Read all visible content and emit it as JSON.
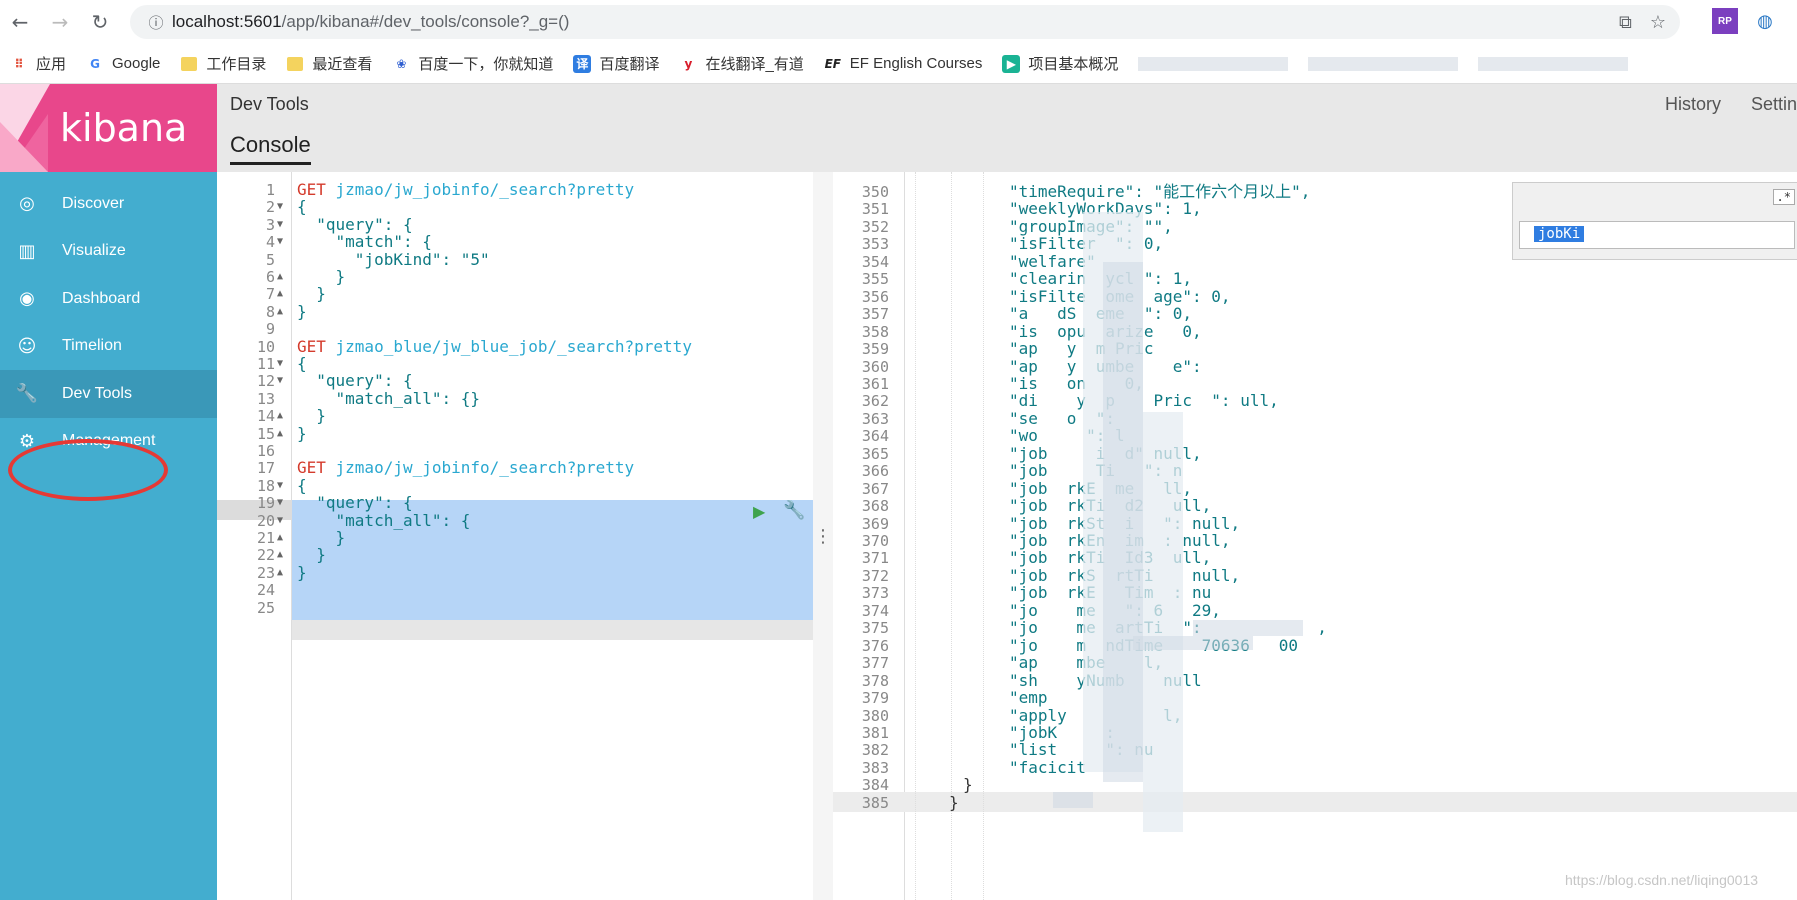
{
  "browser": {
    "url_host": "localhost:5601",
    "url_path": "/app/kibana#/dev_tools/console?_g=()",
    "back": "←",
    "forward": "→",
    "reload": "↻",
    "info": "ⓘ",
    "translate": "⧉",
    "star": "☆",
    "bookmarks": [
      {
        "label": "应用",
        "icon": "apps-grid-icon"
      },
      {
        "label": "Google",
        "icon": "google-icon"
      },
      {
        "label": "工作目录",
        "icon": "folder-icon"
      },
      {
        "label": "最近查看",
        "icon": "folder-icon"
      },
      {
        "label": "百度一下，你就知道",
        "icon": "baidu-icon"
      },
      {
        "label": "百度翻译",
        "icon": "baidu-translate-icon"
      },
      {
        "label": "在线翻译_有道",
        "icon": "youdao-icon"
      },
      {
        "label": "EF English Courses",
        "icon": "ef-icon"
      },
      {
        "label": "项目基本概况",
        "icon": "project-icon"
      }
    ]
  },
  "sidebar": {
    "logo_text": "kibana",
    "items": [
      {
        "label": "Discover",
        "icon": "compass-icon",
        "glyph": "◎"
      },
      {
        "label": "Visualize",
        "icon": "bar-chart-icon",
        "glyph": "▥"
      },
      {
        "label": "Dashboard",
        "icon": "dashboard-icon",
        "glyph": "◉"
      },
      {
        "label": "Timelion",
        "icon": "timelion-icon",
        "glyph": "☺"
      },
      {
        "label": "Dev Tools",
        "icon": "wrench-icon",
        "glyph": "🔧"
      },
      {
        "label": "Management",
        "icon": "gear-icon",
        "glyph": "⚙"
      }
    ]
  },
  "header": {
    "title": "Dev Tools",
    "tab": "Console",
    "history": "History",
    "settings": "Settin"
  },
  "request_editor": {
    "lines": [
      {
        "n": "1",
        "method": "GET",
        "path": "jzmao/jw_jobinfo/_search?pretty"
      },
      {
        "n": "2",
        "text": "{"
      },
      {
        "n": "3",
        "text": "  \"query\": {"
      },
      {
        "n": "4",
        "text": "    \"match\": {"
      },
      {
        "n": "5",
        "text": "      \"jobKind\": \"5\""
      },
      {
        "n": "6",
        "text": "    }"
      },
      {
        "n": "7",
        "text": "  }"
      },
      {
        "n": "8",
        "text": "}"
      },
      {
        "n": "9",
        "text": ""
      },
      {
        "n": "10",
        "method": "GET",
        "path": "jzmao_blue/jw_blue_job/_search?pretty"
      },
      {
        "n": "11",
        "text": "{"
      },
      {
        "n": "12",
        "text": "  \"query\": {"
      },
      {
        "n": "13",
        "text": "    \"match_all\": {}"
      },
      {
        "n": "14",
        "text": "  }"
      },
      {
        "n": "15",
        "text": "}"
      },
      {
        "n": "16",
        "text": ""
      },
      {
        "n": "17",
        "method": "GET",
        "path": "jzmao/jw_jobinfo/_search?pretty"
      },
      {
        "n": "18",
        "text": "{"
      },
      {
        "n": "19",
        "text": "  \"query\": {"
      },
      {
        "n": "20",
        "text": "    \"match_all\": {"
      },
      {
        "n": "21",
        "text": "    }"
      },
      {
        "n": "22",
        "text": "  }"
      },
      {
        "n": "23",
        "text": "}"
      },
      {
        "n": "24",
        "text": ""
      },
      {
        "n": "25",
        "text": ""
      }
    ],
    "play_icon": "▶",
    "wrench_icon": "🔧"
  },
  "response_editor": {
    "lines": [
      {
        "n": "350",
        "text": "\"timeRequire\": \"能工作六个月以上\","
      },
      {
        "n": "351",
        "text": "\"weeklyWorkDays\": 1,"
      },
      {
        "n": "352",
        "text": "\"groupImage\": \"\","
      },
      {
        "n": "353",
        "text": "\"isFilter  \": 0,"
      },
      {
        "n": "354",
        "text": "\"welfare\""
      },
      {
        "n": "355",
        "text": "\"clearin  ycl \": 1,"
      },
      {
        "n": "356",
        "text": "\"isFilte  ome  age\": 0,"
      },
      {
        "n": "357",
        "text": "\"a   dS  eme  \": 0,"
      },
      {
        "n": "358",
        "text": "\"is  opu  arize   0,"
      },
      {
        "n": "359",
        "text": "\"ap   y  m Pric"
      },
      {
        "n": "360",
        "text": "\"ap   y  umbe    e\":"
      },
      {
        "n": "361",
        "text": "\"is   on    0,"
      },
      {
        "n": "362",
        "text": "\"di    y  p    Pric  \": ull,"
      },
      {
        "n": "363",
        "text": "\"se   o  \":"
      },
      {
        "n": "364",
        "text": "\"wo     \": l"
      },
      {
        "n": "365",
        "text": "\"job     i  d\" null,"
      },
      {
        "n": "366",
        "text": "\"job     Ti   \": n"
      },
      {
        "n": "367",
        "text": "\"job  rkE  me   ll,"
      },
      {
        "n": "368",
        "text": "\"job  rkTi  d2   ull,"
      },
      {
        "n": "369",
        "text": "\"job  rkSt  i   \": null,"
      },
      {
        "n": "370",
        "text": "\"job  rkEn  im  : null,"
      },
      {
        "n": "371",
        "text": "\"job  rkTi  Id3  ull,"
      },
      {
        "n": "372",
        "text": "\"job  rkS  rtTi    null,"
      },
      {
        "n": "373",
        "text": "\"job  rkE   Tim  : nu"
      },
      {
        "n": "374",
        "text": "\"jo    me   \": 6   29,"
      },
      {
        "n": "375",
        "text": "\"jo    me  artTi  \":            ,"
      },
      {
        "n": "376",
        "text": "\"jo    m  ndTime    70636   00"
      },
      {
        "n": "377",
        "text": "\"ap    mbe    l,"
      },
      {
        "n": "378",
        "text": "\"sh    yNumb    null"
      },
      {
        "n": "379",
        "text": "\"emp"
      },
      {
        "n": "380",
        "text": "\"apply          l,"
      },
      {
        "n": "381",
        "text": "\"jobK     :"
      },
      {
        "n": "382",
        "text": "\"list     \": nu"
      },
      {
        "n": "383",
        "text": "\"facicit"
      },
      {
        "n": "384",
        "text": "}"
      },
      {
        "n": "385",
        "text": "}"
      }
    ],
    "find_hint": ".*",
    "find_value": "jobKi"
  },
  "watermark": "https://blog.csdn.net/liqing0013",
  "colors": {
    "kibana_pink": "#e8478b",
    "sidebar_blue": "#43adcf",
    "selection": "#b6d5f7",
    "method_red": "#d43b2c",
    "path_blue": "#2aa8d0"
  }
}
